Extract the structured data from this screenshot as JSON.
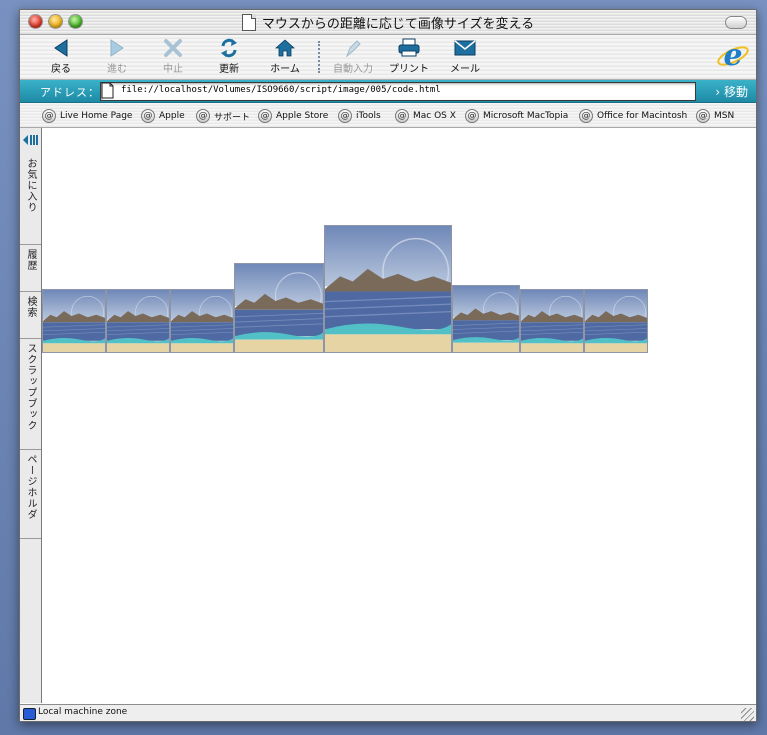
{
  "window": {
    "title": "マウスからの距離に応じて画像サイズを変える"
  },
  "toolbar": {
    "buttons": [
      {
        "label": "戻る",
        "icon": "back-arrow-icon",
        "enabled": true
      },
      {
        "label": "進む",
        "icon": "forward-arrow-icon",
        "enabled": false
      },
      {
        "label": "中止",
        "icon": "stop-icon",
        "enabled": false
      },
      {
        "label": "更新",
        "icon": "refresh-icon",
        "enabled": true
      },
      {
        "label": "ホーム",
        "icon": "home-icon",
        "enabled": true
      },
      {
        "label": "自動入力",
        "icon": "autofill-icon",
        "enabled": false
      },
      {
        "label": "プリント",
        "icon": "print-icon",
        "enabled": true
      },
      {
        "label": "メール",
        "icon": "mail-icon",
        "enabled": true
      }
    ]
  },
  "address": {
    "label": "アドレス：",
    "url": "file://localhost/Volumes/ISO9660/script/image/005/code.html",
    "go_label": "移動"
  },
  "favorites": [
    "Live Home Page",
    "Apple",
    "サポート",
    "Apple Store",
    "iTools",
    "Mac OS X",
    "Microsoft MacTopia",
    "Office for Macintosh",
    "MSN"
  ],
  "sidebar": {
    "tabs": [
      "お気に入り",
      "履歴",
      "検索",
      "スクラップブック",
      "ページホルダ"
    ]
  },
  "status": {
    "text": "Local machine zone"
  },
  "colors": {
    "address_bar": "#1e8aa6",
    "accent_icon": "#1d6fa0"
  }
}
